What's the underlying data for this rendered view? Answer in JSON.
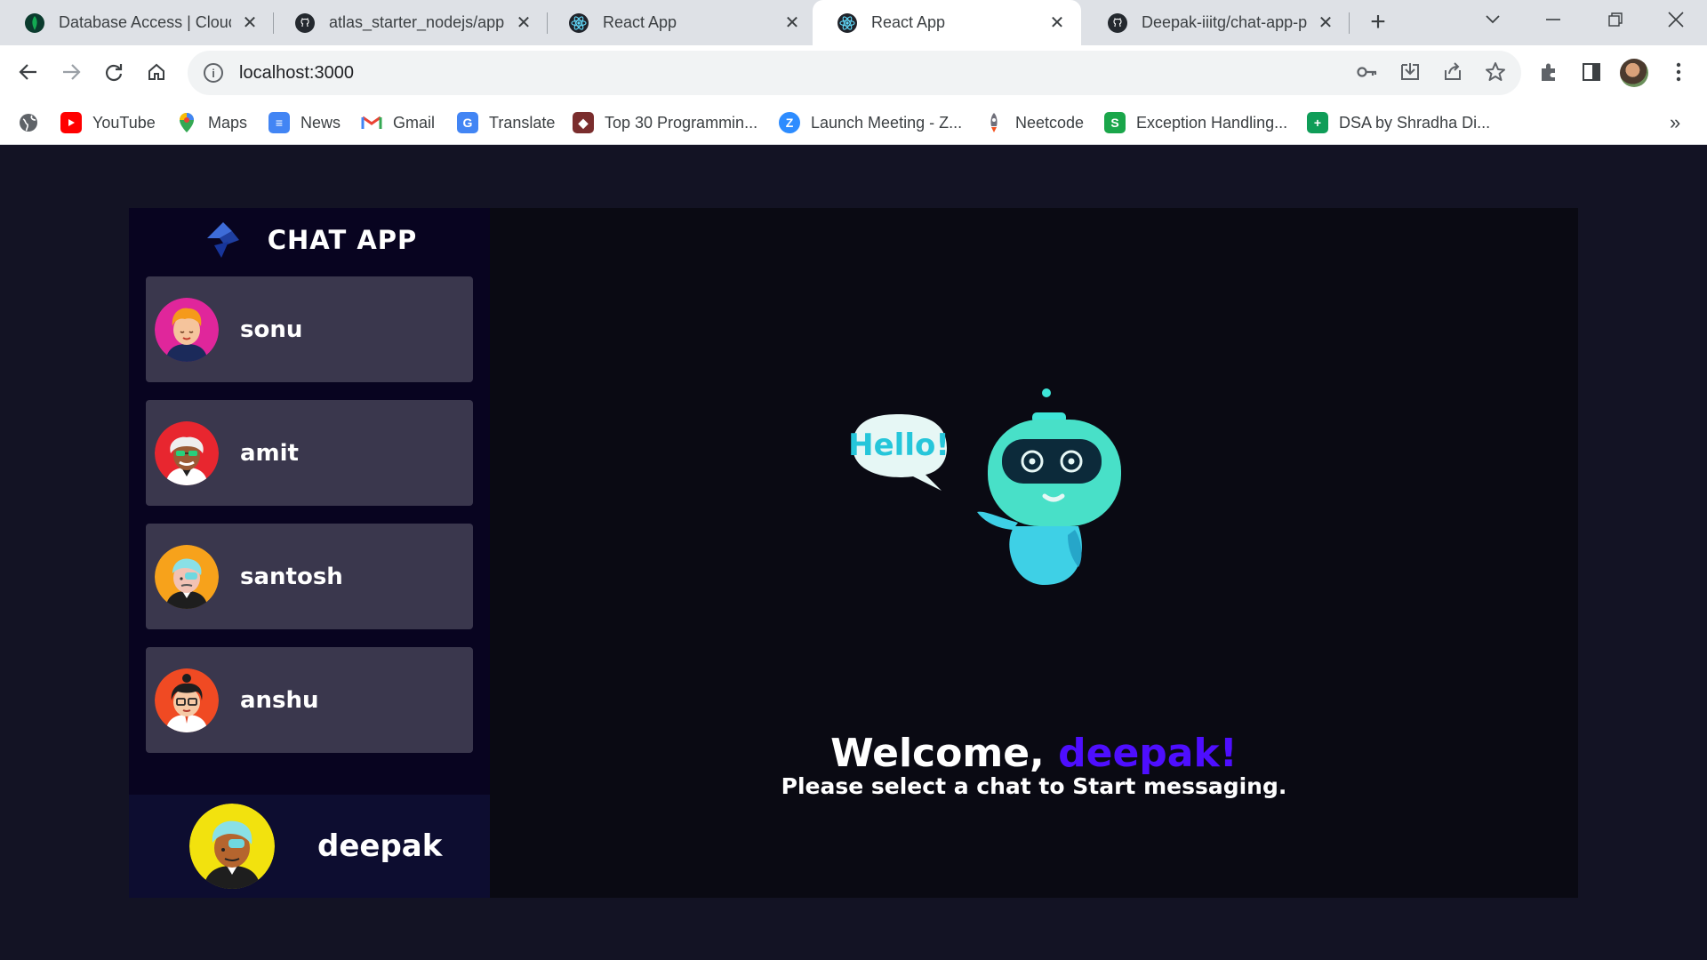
{
  "browser": {
    "tabs": [
      {
        "title": "Database Access | Cloud: M",
        "icon": "mongodb-leaf-icon"
      },
      {
        "title": "atlas_starter_nodejs/app.js",
        "icon": "github-icon"
      },
      {
        "title": "React App",
        "icon": "react-icon"
      },
      {
        "title": "React App",
        "icon": "react-icon",
        "active": true
      },
      {
        "title": "Deepak-iiitg/chat-app-pr",
        "icon": "github-icon"
      }
    ],
    "url": "localhost:3000",
    "bookmarks": [
      {
        "label": "YouTube",
        "icon": "youtube-icon"
      },
      {
        "label": "Maps",
        "icon": "maps-pin-icon"
      },
      {
        "label": "News",
        "icon": "news-icon"
      },
      {
        "label": "Gmail",
        "icon": "gmail-icon"
      },
      {
        "label": "Translate",
        "icon": "translate-icon"
      },
      {
        "label": "Top 30 Programmin...",
        "icon": "bookmark-site-icon"
      },
      {
        "label": "Launch Meeting - Z...",
        "icon": "zoom-icon"
      },
      {
        "label": "Neetcode",
        "icon": "rocket-icon"
      },
      {
        "label": "Exception Handling...",
        "icon": "s-icon"
      },
      {
        "label": "DSA by Shradha Di...",
        "icon": "sheets-icon"
      }
    ],
    "overflow_glyph": "»"
  },
  "app": {
    "brand": {
      "title": "CHAT APP",
      "icon": "logo-icon"
    },
    "contacts": [
      {
        "name": "sonu",
        "avatar_bg": "#e0269b"
      },
      {
        "name": "amit",
        "avatar_bg": "#e8262f"
      },
      {
        "name": "santosh",
        "avatar_bg": "#f7a21b"
      },
      {
        "name": "anshu",
        "avatar_bg": "#f04a23"
      }
    ],
    "current_user": {
      "name": "deepak",
      "avatar_bg": "#f2e20e"
    },
    "welcome": {
      "greeting": "Welcome,",
      "username": "deepak!",
      "subtitle": "Please select a chat to Start messaging.",
      "bubble_text": "Hello!"
    }
  },
  "colors": {
    "page_bg": "#131324",
    "sidebar_bg": "#080420",
    "contact_bg": "#3c3850",
    "accent": "#4e0eff",
    "robot": "#3ee6d8"
  }
}
